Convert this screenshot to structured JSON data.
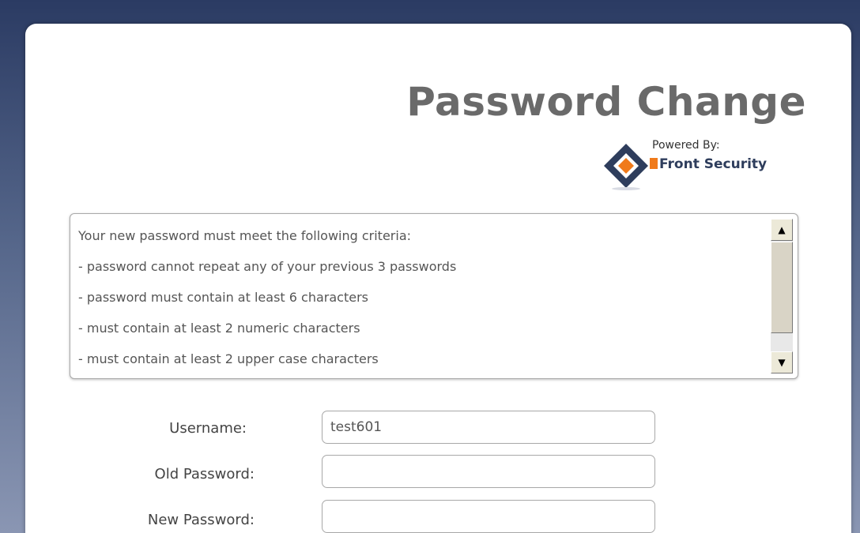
{
  "page": {
    "title": "Password Change"
  },
  "brand": {
    "powered_by": "Powered By:",
    "name": "Front Security"
  },
  "criteria": {
    "heading": "Your new password must meet the following criteria:",
    "items": [
      " - password cannot repeat any of your previous 3 passwords",
      " - password must contain at least 6 characters",
      " - must contain at least 2 numeric characters",
      " - must contain at least 2 upper case characters"
    ]
  },
  "form": {
    "username_label": "Username:",
    "username_value": "test601",
    "old_password_label": "Old Password:",
    "old_password_value": "",
    "new_password_label": "New Password:",
    "new_password_value": ""
  },
  "colors": {
    "title": "#6a6a6a",
    "brand_text": "#2e3d5c",
    "brand_accent": "#f07a1a",
    "background": "#2b3b63"
  },
  "icons": {
    "logo": "diamond-logo-icon",
    "scroll_up": "arrow-up-icon",
    "scroll_down": "arrow-down-icon"
  }
}
